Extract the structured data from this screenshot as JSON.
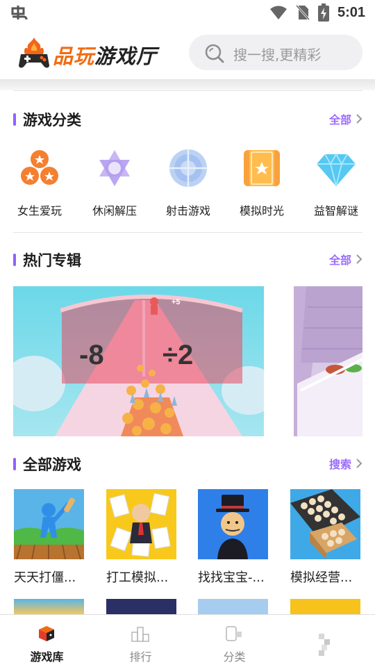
{
  "status_bar": {
    "left_icon": "carrier-logo-icon",
    "icons": [
      "wifi-icon",
      "no-sim-icon",
      "battery-charging-icon"
    ],
    "time": "5:01"
  },
  "header": {
    "logo_text_1": "品玩",
    "logo_text_2": "游戏厅",
    "logo_icon": "gamepad-fire-icon",
    "search_placeholder": "搜一搜,更精彩",
    "search_icon": "search-icon"
  },
  "categories_section": {
    "title": "游戏分类",
    "more": "全部",
    "items": [
      {
        "label": "女生爱玩",
        "icon": "three-stars-circles-icon",
        "color": "#f57f30"
      },
      {
        "label": "休闲解压",
        "icon": "hexagram-icon",
        "color": "#b9a3ef"
      },
      {
        "label": "射击游戏",
        "icon": "crosshair-icon",
        "color": "#8fb4ec"
      },
      {
        "label": "模拟时光",
        "icon": "star-card-icon",
        "color": "#f9a13d"
      },
      {
        "label": "益智解谜",
        "icon": "diamond-icon",
        "color": "#55c8f3"
      }
    ]
  },
  "hot_section": {
    "title": "热门专辑",
    "more": "全部",
    "banner": {
      "gate_left": "-8",
      "gate_right": "÷2",
      "marker": "+5"
    }
  },
  "all_games_section": {
    "title": "全部游戏",
    "more": "搜索",
    "games": [
      {
        "name": "天天打僵..."
      },
      {
        "name": "打工模拟..."
      },
      {
        "name": "找找宝宝-..."
      },
      {
        "name": "模拟经营..."
      }
    ]
  },
  "bottom_nav": {
    "items": [
      {
        "label": "游戏库",
        "icon": "game-cube-icon",
        "active": true
      },
      {
        "label": "排行",
        "icon": "podium-icon",
        "active": false
      },
      {
        "label": "分类",
        "icon": "category-icon",
        "active": false
      },
      {
        "label": "",
        "icon": "profile-icon",
        "active": false
      }
    ]
  },
  "colors": {
    "accent": "#9b6cff",
    "logo_orange": "#f26b10",
    "search_bg": "#f0f0f2"
  }
}
